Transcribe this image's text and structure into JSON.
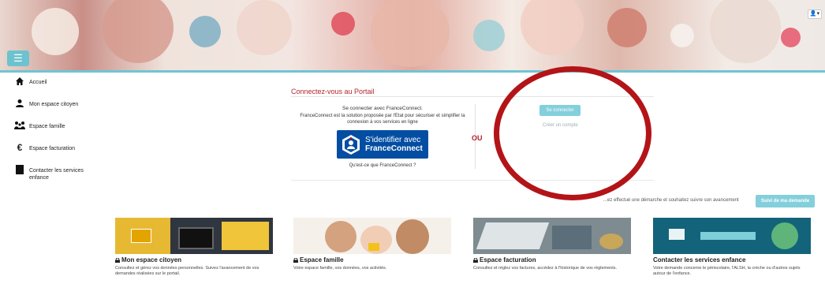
{
  "banner": {
    "menu_icon": "hamburger-icon",
    "user_icon": "user-icon"
  },
  "user_menu_label": "▾",
  "sidebar": {
    "items": [
      {
        "label": "Accueil",
        "icon": "home-icon"
      },
      {
        "label": "Mon espace citoyen",
        "icon": "user-icon"
      },
      {
        "label": "Espace famille",
        "icon": "family-icon"
      },
      {
        "label": "Espace facturation",
        "icon": "euro-icon"
      },
      {
        "label": "Contacter les services enfance",
        "icon": "contact-icon"
      }
    ]
  },
  "login": {
    "title": "Connectez-vous au Portail",
    "fc_title": "Se connecter avec FranceConnect.",
    "fc_desc": "FranceConnect est la solution proposée par l'Etat pour sécuriser et simplifier la connexion à vos services en ligne",
    "fc_button_line1": "S'identifier avec",
    "fc_button_line2": "FranceConnect",
    "fc_link": "Qu'est-ce que FranceConnect ?",
    "or_label": "OU",
    "connect_button": "Se connecter",
    "create_account": "Créer un compte"
  },
  "follow": {
    "text": "...ez effectué une démarche et souhaitez suivre son avancement",
    "button": "Suivi de ma demande"
  },
  "cards": [
    {
      "title": "Mon espace citoyen",
      "desc": "Consultez et gérez vos données personnelles. Suivez l'avancement de vos demandes réalisées sur le portail.",
      "locked": true
    },
    {
      "title": "Espace famille",
      "desc": "Votre espace famille, vos données, vos activités.",
      "locked": true
    },
    {
      "title": "Espace facturation",
      "desc": "Consultez et réglez vos factures, accédez à l'historique de vos règlements.",
      "locked": true
    },
    {
      "title": "Contacter les services enfance",
      "desc": "Votre demande concerne le périscolaire, l'ALSH, la crèche ou d'autres sujets autour de l'enfance.",
      "locked": false
    }
  ],
  "colors": {
    "accent": "#6cc3cf",
    "title_red": "#b3242c",
    "fc_blue": "#034ea2",
    "annotation_red": "#b31418"
  }
}
